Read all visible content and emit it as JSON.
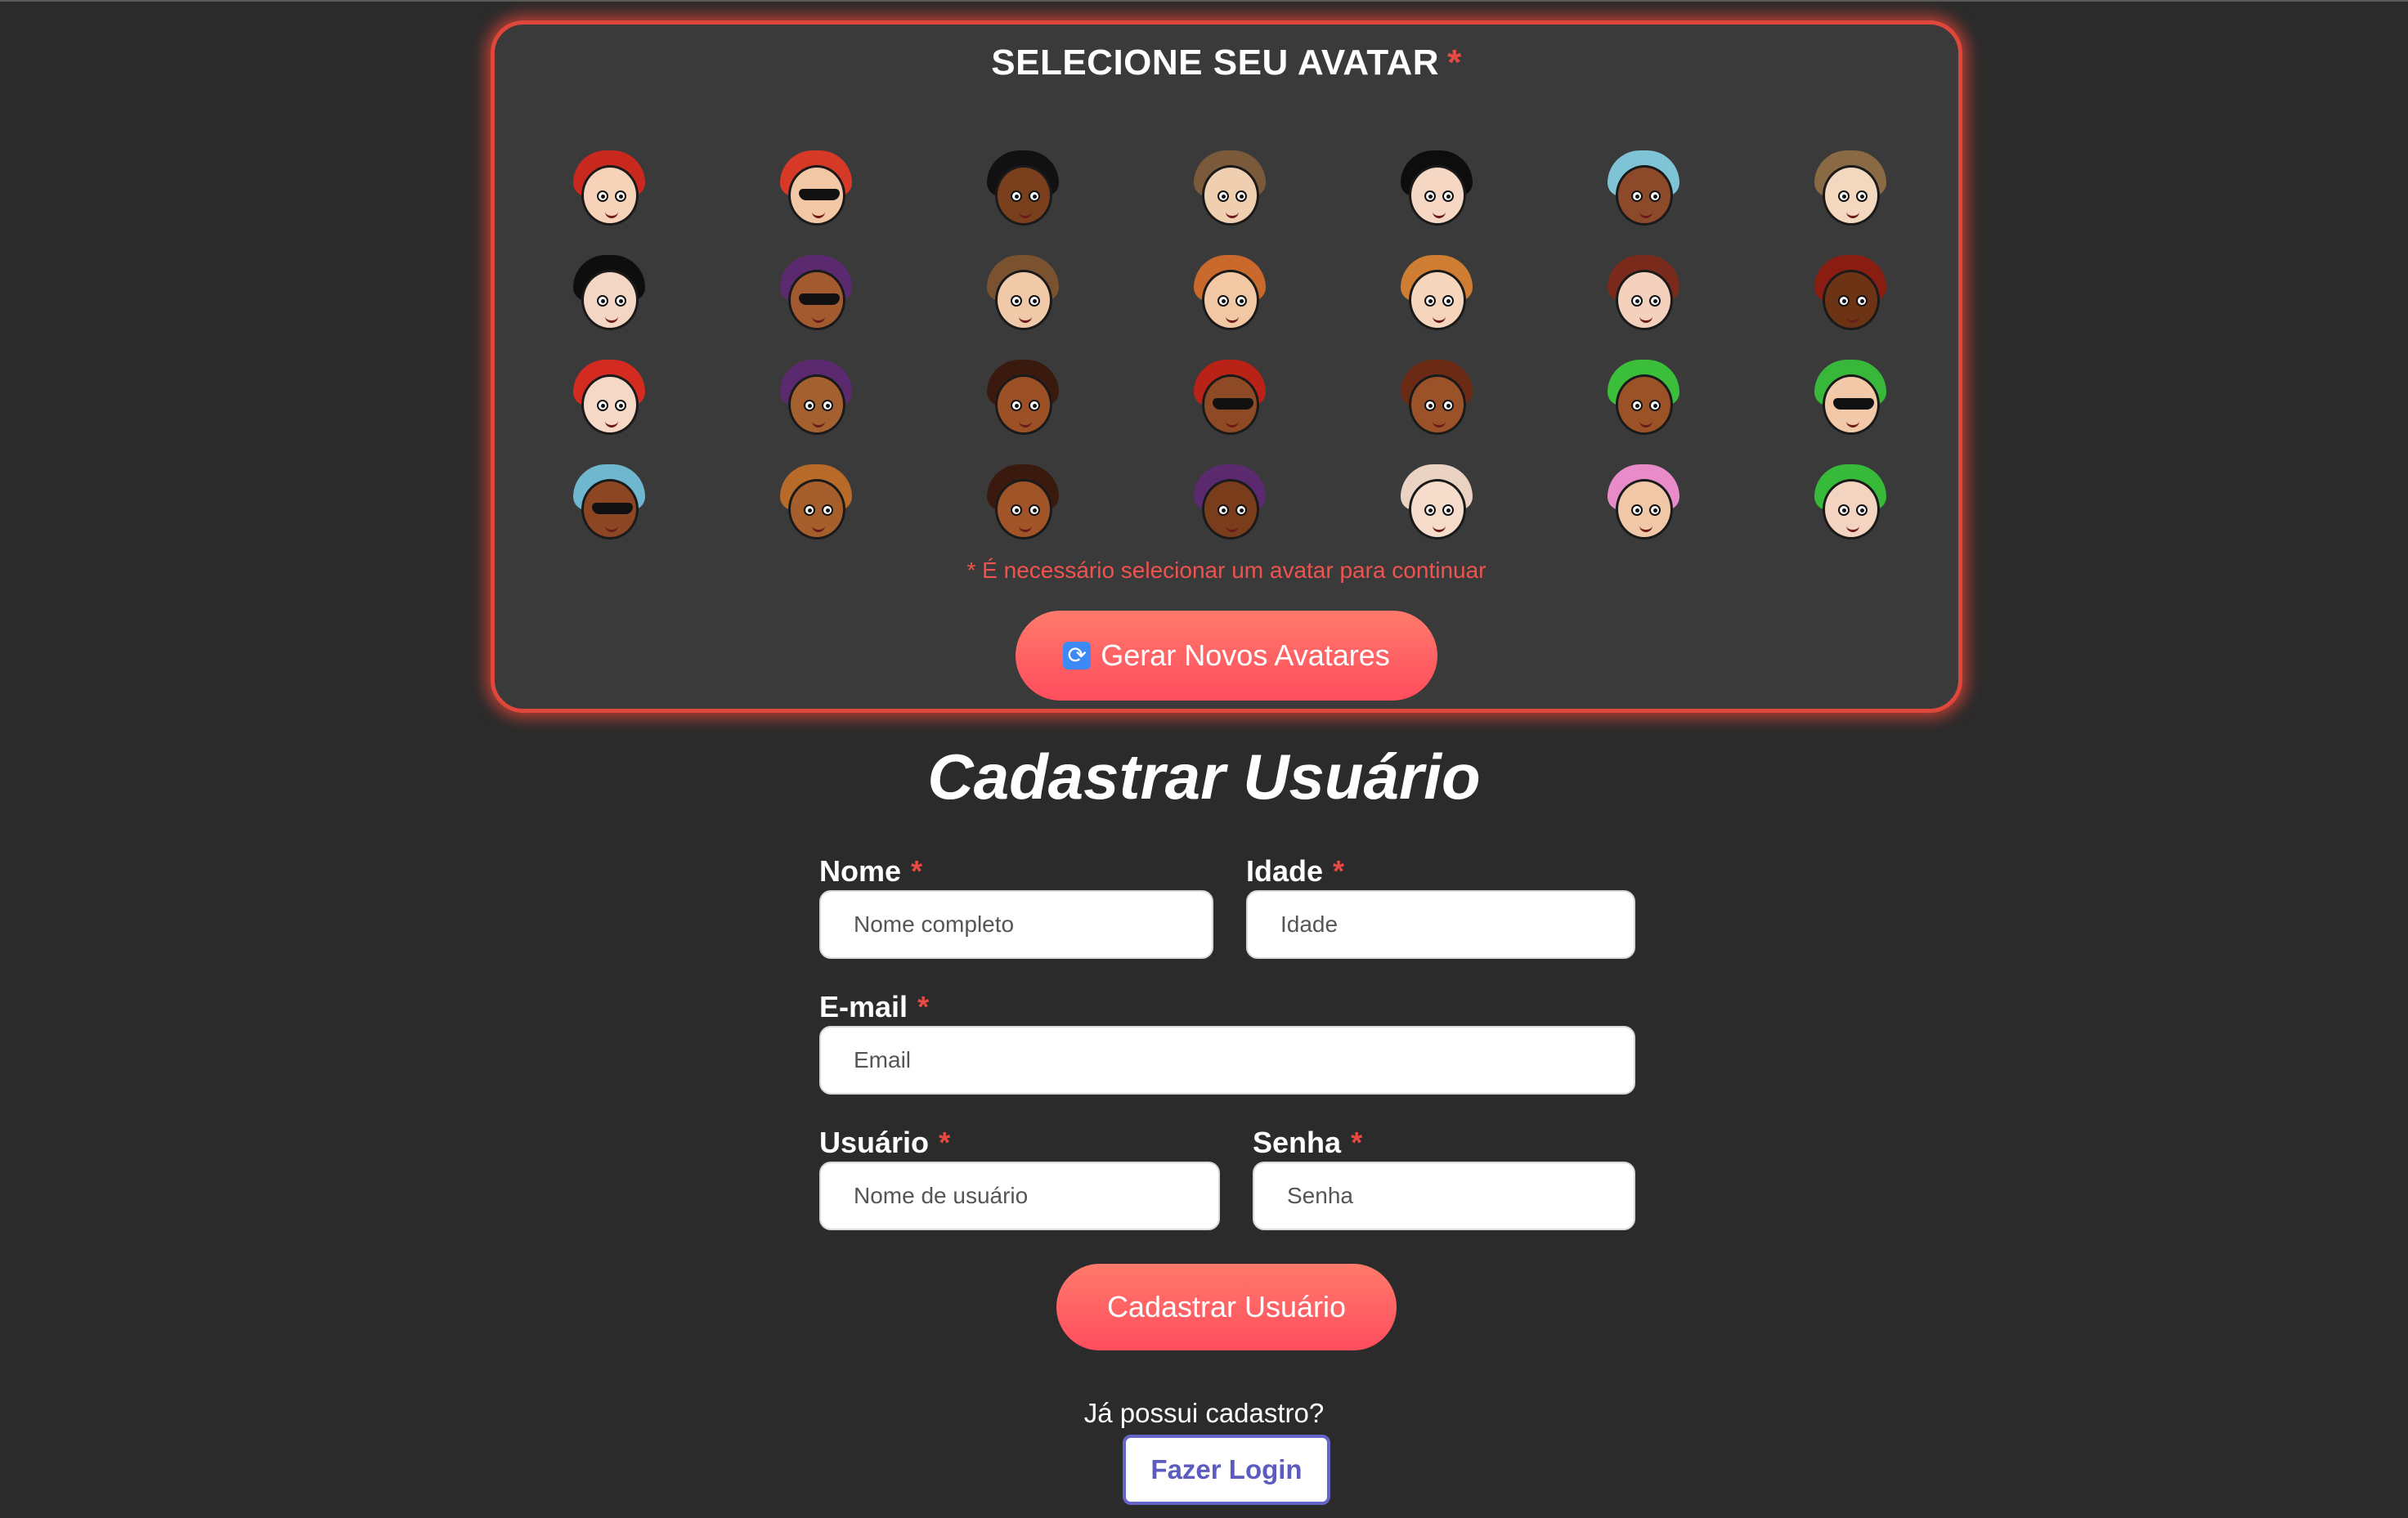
{
  "avatar_section": {
    "title": "SELECIONE SEU AVATAR",
    "required_mark": "*",
    "warning": "* É necessário selecionar um avatar para continuar",
    "regenerate_label": "Gerar Novos Avatares",
    "avatars": [
      {
        "hair": "#c8281d",
        "skin": "#f6d2b8",
        "shades": false
      },
      {
        "hair": "#d63a27",
        "skin": "#f2c7a5",
        "shades": true
      },
      {
        "hair": "#111111",
        "skin": "#7a3f1d",
        "shades": false
      },
      {
        "hair": "#7b5a3c",
        "skin": "#efcfb0",
        "shades": false
      },
      {
        "hair": "#0d0d0d",
        "skin": "#f5d7c3",
        "shades": false
      },
      {
        "hair": "#7fc4d6",
        "skin": "#8c4a2b",
        "shades": false
      },
      {
        "hair": "#8a6a44",
        "skin": "#f3d7bf",
        "shades": false
      },
      {
        "hair": "#0e0e0e",
        "skin": "#f4d6c4",
        "shades": false
      },
      {
        "hair": "#5b2a6e",
        "skin": "#a45a2f",
        "shades": true
      },
      {
        "hair": "#7b5230",
        "skin": "#f0c9a9",
        "shades": false
      },
      {
        "hair": "#c96a2c",
        "skin": "#f2c8a4",
        "shades": false
      },
      {
        "hair": "#cf7d32",
        "skin": "#f5d6bd",
        "shades": false
      },
      {
        "hair": "#7a2a1a",
        "skin": "#f4d1bd",
        "shades": false
      },
      {
        "hair": "#8a1d12",
        "skin": "#6d3315",
        "shades": false
      },
      {
        "hair": "#d42b20",
        "skin": "#f5d8c6",
        "shades": false
      },
      {
        "hair": "#5b2a6e",
        "skin": "#a4602f",
        "shades": false
      },
      {
        "hair": "#3a1a0e",
        "skin": "#9b5025",
        "shades": false
      },
      {
        "hair": "#b82217",
        "skin": "#8e4a24",
        "shades": true
      },
      {
        "hair": "#6a2a14",
        "skin": "#9c5228",
        "shades": false
      },
      {
        "hair": "#3bbf3b",
        "skin": "#9b5227",
        "shades": false
      },
      {
        "hair": "#38b83a",
        "skin": "#f2c9a8",
        "shades": true
      },
      {
        "hair": "#6fb7cf",
        "skin": "#8c4624",
        "shades": true
      },
      {
        "hair": "#b86a29",
        "skin": "#a55e2c",
        "shades": false
      },
      {
        "hair": "#3a1a0e",
        "skin": "#a05428",
        "shades": false
      },
      {
        "hair": "#5b2a6e",
        "skin": "#7a3d1b",
        "shades": false
      },
      {
        "hair": "#ead3c3",
        "skin": "#f5dccb",
        "shades": false
      },
      {
        "hair": "#e98bc8",
        "skin": "#f0c8a7",
        "shades": false
      },
      {
        "hair": "#37b93a",
        "skin": "#f3d4c0",
        "shades": false
      }
    ]
  },
  "form": {
    "title": "Cadastrar Usuário",
    "required_mark": "*",
    "name": {
      "label": "Nome",
      "placeholder": "Nome completo"
    },
    "age": {
      "label": "Idade",
      "placeholder": "Idade"
    },
    "email": {
      "label": "E-mail",
      "placeholder": "Email"
    },
    "username": {
      "label": "Usuário",
      "placeholder": "Nome de usuário"
    },
    "password": {
      "label": "Senha",
      "placeholder": "Senha"
    },
    "submit_label": "Cadastrar Usuário",
    "login_prompt": "Já possui cadastro?",
    "login_label": "Fazer Login"
  },
  "colors": {
    "background": "#2b2b2b",
    "panel": "#3b3a3a",
    "panel_border": "#e0473b",
    "accent_gradient_top": "#ff7a6b",
    "accent_gradient_bottom": "#ff4d5e",
    "required": "#e84a43",
    "login_border": "#6665c8"
  },
  "icons": {
    "regenerate": "refresh-icon"
  }
}
